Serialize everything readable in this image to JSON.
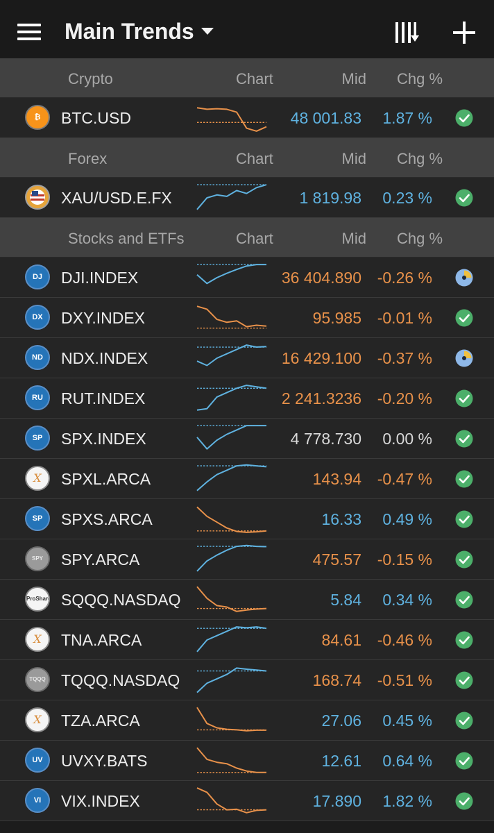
{
  "header": {
    "title": "Main Trends"
  },
  "columns": {
    "chart": "Chart",
    "mid": "Mid",
    "chg": "Chg %"
  },
  "sections": [
    {
      "name": "Crypto",
      "rows": [
        {
          "symbol": "BTC.USD",
          "logo": "bitcoin-logo-icon",
          "logo_text": "₿",
          "mid": "48 001.83",
          "chg": "1.87 %",
          "direction": "up",
          "status": "ok",
          "spark": [
            0.15,
            0.2,
            0.18,
            0.2,
            0.3,
            0.85,
            0.95,
            0.8
          ],
          "spark_ref": 0.65
        }
      ]
    },
    {
      "name": "Forex",
      "rows": [
        {
          "symbol": "XAU/USD.E.FX",
          "logo": "usd-flag-icon",
          "logo_text": "",
          "mid": "1 819.98",
          "chg": "0.23 %",
          "direction": "up",
          "status": "ok",
          "spark": [
            0.9,
            0.5,
            0.4,
            0.45,
            0.25,
            0.35,
            0.15,
            0.05
          ],
          "spark_ref": 0.05
        }
      ]
    },
    {
      "name": "Stocks and ETFs",
      "rows": [
        {
          "symbol": "DJI.INDEX",
          "logo": "dj-logo-icon",
          "logo_text": "DJ",
          "mid": "36 404.890",
          "chg": "-0.26 %",
          "direction": "down",
          "status": "partial",
          "spark": [
            0.4,
            0.7,
            0.5,
            0.35,
            0.22,
            0.1,
            0.05,
            0.05
          ],
          "spark_ref": 0.05
        },
        {
          "symbol": "DXY.INDEX",
          "logo": "dx-logo-icon",
          "logo_text": "DX",
          "mid": "95.985",
          "chg": "-0.01 %",
          "direction": "down",
          "status": "ok",
          "spark": [
            0.1,
            0.2,
            0.55,
            0.65,
            0.6,
            0.8,
            0.75,
            0.78
          ],
          "spark_ref": 0.85
        },
        {
          "symbol": "NDX.INDEX",
          "logo": "nd-logo-icon",
          "logo_text": "ND",
          "mid": "16 429.100",
          "chg": "-0.37 %",
          "direction": "down",
          "status": "partial",
          "spark": [
            0.6,
            0.75,
            0.5,
            0.35,
            0.2,
            0.05,
            0.12,
            0.1
          ],
          "spark_ref": 0.12
        },
        {
          "symbol": "RUT.INDEX",
          "logo": "ru-logo-icon",
          "logo_text": "RU",
          "mid": "2 241.3236",
          "chg": "-0.20 %",
          "direction": "down",
          "status": "ok",
          "spark": [
            0.9,
            0.85,
            0.45,
            0.3,
            0.15,
            0.05,
            0.1,
            0.15
          ],
          "spark_ref": 0.15
        },
        {
          "symbol": "SPX.INDEX",
          "logo": "sp-logo-icon",
          "logo_text": "SP",
          "mid": "4 778.730",
          "chg": "0.00 %",
          "direction": "flat",
          "status": "ok",
          "spark": [
            0.45,
            0.85,
            0.55,
            0.35,
            0.2,
            0.05,
            0.05,
            0.05
          ],
          "spark_ref": 0.05
        },
        {
          "symbol": "SPXL.ARCA",
          "logo": "direxion-logo-icon",
          "logo_text": "X",
          "mid": "143.94",
          "chg": "-0.47 %",
          "direction": "down",
          "status": "ok",
          "spark": [
            0.9,
            0.6,
            0.35,
            0.2,
            0.05,
            0.02,
            0.05,
            0.08
          ],
          "spark_ref": 0.05
        },
        {
          "symbol": "SPXS.ARCA",
          "logo": "sp-logo-icon",
          "logo_text": "SP",
          "mid": "16.33",
          "chg": "0.49 %",
          "direction": "up",
          "status": "ok",
          "spark": [
            0.08,
            0.4,
            0.6,
            0.8,
            0.92,
            0.95,
            0.93,
            0.9
          ],
          "spark_ref": 0.9
        },
        {
          "symbol": "SPY.ARCA",
          "logo": "spy-logo-icon",
          "logo_text": "SPY",
          "mid": "475.57",
          "chg": "-0.15 %",
          "direction": "down",
          "status": "ok",
          "spark": [
            0.9,
            0.55,
            0.35,
            0.18,
            0.05,
            0.02,
            0.05,
            0.06
          ],
          "spark_ref": 0.05
        },
        {
          "symbol": "SQQQ.NASDAQ",
          "logo": "proshares-logo-icon",
          "logo_text": "ProShares",
          "mid": "5.84",
          "chg": "0.34 %",
          "direction": "up",
          "status": "ok",
          "spark": [
            0.05,
            0.45,
            0.7,
            0.75,
            0.9,
            0.85,
            0.82,
            0.8
          ],
          "spark_ref": 0.8
        },
        {
          "symbol": "TNA.ARCA",
          "logo": "direxion-logo-icon",
          "logo_text": "X",
          "mid": "84.61",
          "chg": "-0.46 %",
          "direction": "down",
          "status": "ok",
          "spark": [
            0.9,
            0.5,
            0.35,
            0.2,
            0.05,
            0.08,
            0.05,
            0.1
          ],
          "spark_ref": 0.1
        },
        {
          "symbol": "TQQQ.NASDAQ",
          "logo": "tqqq-logo-icon",
          "logo_text": "TQQQ",
          "mid": "168.74",
          "chg": "-0.51 %",
          "direction": "down",
          "status": "ok",
          "spark": [
            0.92,
            0.6,
            0.45,
            0.3,
            0.08,
            0.12,
            0.15,
            0.18
          ],
          "spark_ref": 0.18
        },
        {
          "symbol": "TZA.ARCA",
          "logo": "direxion-logo-icon",
          "logo_text": "X",
          "mid": "27.06",
          "chg": "0.45 %",
          "direction": "up",
          "status": "ok",
          "spark": [
            0.05,
            0.6,
            0.75,
            0.8,
            0.82,
            0.85,
            0.83,
            0.83
          ],
          "spark_ref": 0.82
        },
        {
          "symbol": "UVXY.BATS",
          "logo": "uv-logo-icon",
          "logo_text": "UV",
          "mid": "12.61",
          "chg": "0.64 %",
          "direction": "up",
          "status": "ok",
          "spark": [
            0.05,
            0.45,
            0.55,
            0.6,
            0.75,
            0.85,
            0.9,
            0.9
          ],
          "spark_ref": 0.9
        },
        {
          "symbol": "VIX.INDEX",
          "logo": "vi-logo-icon",
          "logo_text": "VI",
          "mid": "17.890",
          "chg": "1.82 %",
          "direction": "up",
          "status": "ok",
          "spark": [
            0.05,
            0.2,
            0.6,
            0.8,
            0.78,
            0.9,
            0.82,
            0.8
          ],
          "spark_ref": 0.8
        }
      ]
    }
  ],
  "colors": {
    "negative": "#e8914a",
    "positive": "#5fb2e0",
    "neutral": "#d8d8d8",
    "ok": "#4caf6a",
    "partial": "#8eb8e8",
    "partial_accent": "#f0c040"
  },
  "icons": {
    "menu": "hamburger-menu-icon",
    "dropdown": "dropdown-caret-icon",
    "sort": "sort-columns-icon",
    "add": "plus-icon",
    "ok": "check-circle-icon",
    "partial": "pie-clock-icon"
  }
}
